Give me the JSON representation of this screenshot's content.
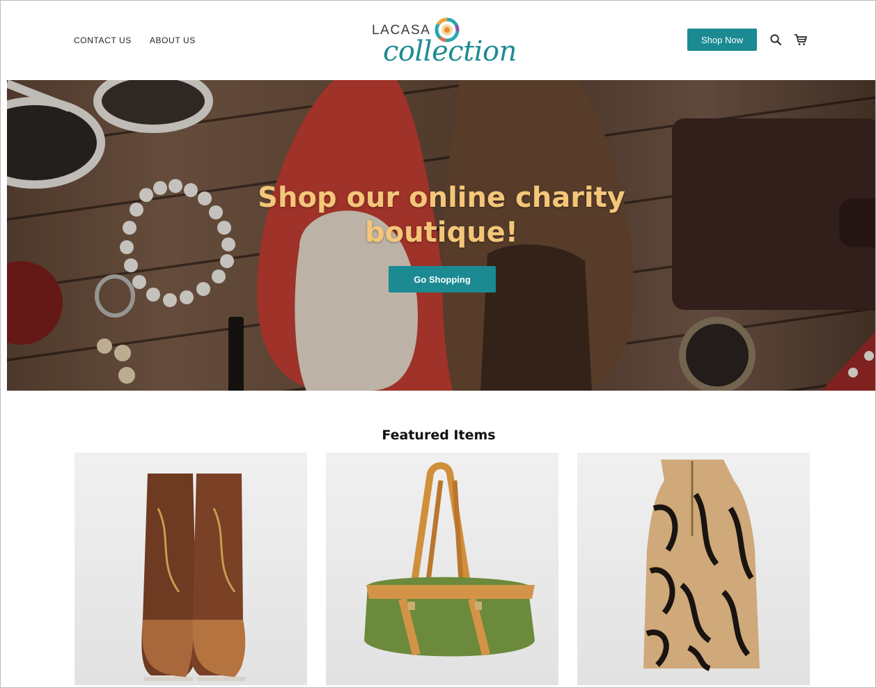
{
  "header": {
    "nav_left": [
      {
        "label": "CONTACT US"
      },
      {
        "label": "ABOUT US"
      }
    ],
    "logo": {
      "top_text": "LACASA",
      "bottom_text": "collection"
    },
    "shop_now_label": "Shop Now",
    "icons": [
      "search-icon",
      "cart-icon"
    ]
  },
  "hero": {
    "title_line1": "Shop our online charity",
    "title_line2": "boutique!",
    "cta_label": "Go Shopping"
  },
  "featured": {
    "title": "Featured Items",
    "items": [
      {
        "image": "cowboy-boots"
      },
      {
        "image": "green-handbag"
      },
      {
        "image": "zebra-print-top"
      }
    ]
  },
  "colors": {
    "accent": "#1b8a93",
    "hero_text": "#f4c679",
    "logo_teal": "#1f8b93"
  }
}
